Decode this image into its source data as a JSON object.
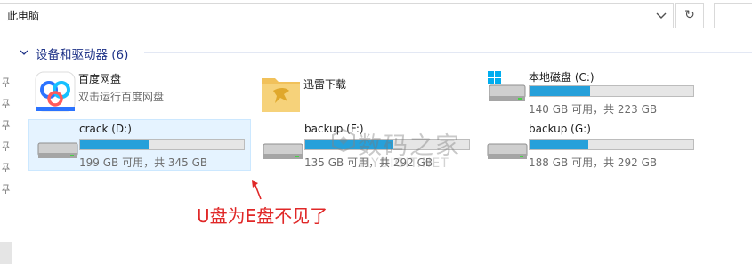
{
  "address_bar": {
    "path": "此电脑"
  },
  "group": {
    "title": "设备和驱动器 (6)"
  },
  "apps": [
    {
      "name": "百度网盘",
      "subtitle": "双击运行百度网盘",
      "icon": "baidu-netdisk-icon"
    },
    {
      "name": "迅雷下载",
      "icon": "xunlei-folder-icon"
    }
  ],
  "drives": [
    {
      "name": "本地磁盘 (C:)",
      "free": "140 GB 可用，共 223 GB",
      "used_fraction": 0.37,
      "icon": "windows-drive-icon"
    },
    {
      "name": "crack (D:)",
      "free": "199 GB 可用，共 345 GB",
      "used_fraction": 0.42,
      "icon": "hard-drive-icon"
    },
    {
      "name": "backup (F:)",
      "free": "135 GB 可用，共 292 GB",
      "used_fraction": 0.54,
      "icon": "hard-drive-icon"
    },
    {
      "name": "backup (G:)",
      "free": "188 GB 可用，共 292 GB",
      "used_fraction": 0.36,
      "icon": "hard-drive-icon"
    }
  ],
  "annotation": {
    "text": "U盘为E盘不见了"
  },
  "watermark": {
    "main": "数码之家",
    "sub": "MYDIGIT.NET"
  },
  "colors": {
    "bar_fill": "#26a0da",
    "group_title": "#1e3287",
    "annotation": "#e02828",
    "selection": "#e5f3ff"
  }
}
